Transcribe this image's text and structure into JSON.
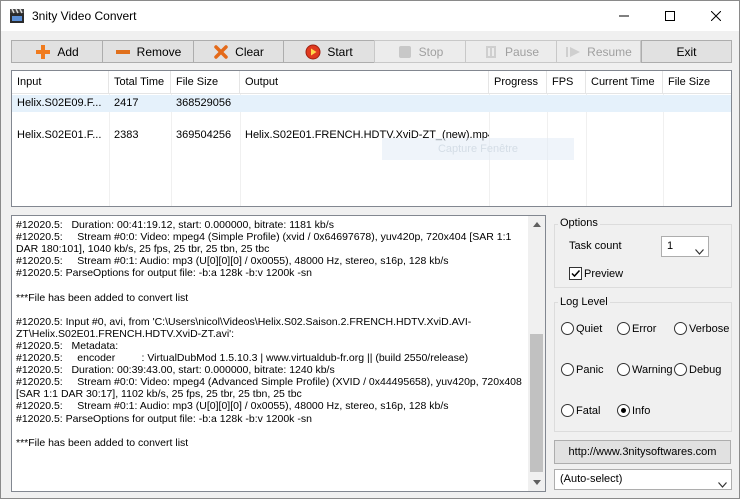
{
  "window": {
    "title": "3nity Video Convert"
  },
  "toolbar": {
    "add_label": "Add",
    "remove_label": "Remove",
    "clear_label": "Clear",
    "start_label": "Start",
    "stop_label": "Stop",
    "pause_label": "Pause",
    "resume_label": "Resume",
    "exit_label": "Exit"
  },
  "list": {
    "columns": [
      "Input",
      "Total Time",
      "File Size",
      "Output",
      "Progress",
      "FPS",
      "Current Time",
      "File Size"
    ],
    "rows": [
      {
        "input": "Helix.S02E09.F...",
        "total_time": "2417",
        "file_size": "368529056",
        "output": ""
      },
      {
        "input": "Helix.S02E01.F...",
        "total_time": "2383",
        "file_size": "369504256",
        "output": "Helix.S02E01.FRENCH.HDTV.XviD-ZT_(new).mp4"
      }
    ],
    "ghost_text": "Capture Fenêtre"
  },
  "log": {
    "text": "#12020.5:   Duration: 00:41:19.12, start: 0.000000, bitrate: 1181 kb/s\n#12020.5:     Stream #0:0: Video: mpeg4 (Simple Profile) (xvid / 0x64697678), yuv420p, 720x404 [SAR 1:1 DAR 180:101], 1040 kb/s, 25 fps, 25 tbr, 25 tbn, 25 tbc\n#12020.5:     Stream #0:1: Audio: mp3 (U[0][0][0] / 0x0055), 48000 Hz, stereo, s16p, 128 kb/s\n#12020.5: ParseOptions for output file: -b:a 128k -b:v 1200k -sn\n\n***File has been added to convert list\n\n#12020.5: Input #0, avi, from 'C:\\Users\\nicol\\Videos\\Helix.S02.Saison.2.FRENCH.HDTV.XviD.AVI-ZT\\Helix.S02E01.FRENCH.HDTV.XviD-ZT.avi':\n#12020.5:   Metadata:\n#12020.5:     encoder         : VirtualDubMod 1.5.10.3 | www.virtualdub-fr.org || (build 2550/release)\n#12020.5:   Duration: 00:39:43.00, start: 0.000000, bitrate: 1240 kb/s\n#12020.5:     Stream #0:0: Video: mpeg4 (Advanced Simple Profile) (XVID / 0x44495658), yuv420p, 720x408 [SAR 1:1 DAR 30:17], 1102 kb/s, 25 fps, 25 tbr, 25 tbn, 25 tbc\n#12020.5:     Stream #0:1: Audio: mp3 (U[0][0][0] / 0x0055), 48000 Hz, stereo, s16p, 128 kb/s\n#12020.5: ParseOptions for output file: -b:a 128k -b:v 1200k -sn\n\n***File has been added to convert list"
  },
  "options": {
    "title": "Options",
    "task_count_label": "Task count",
    "task_count_value": "1",
    "preview_label": "Preview",
    "preview_checked": true
  },
  "log_level": {
    "title": "Log Level",
    "quiet": "Quiet",
    "error": "Error",
    "verbose": "Verbose",
    "panic": "Panic",
    "warning": "Warning",
    "debug": "Debug",
    "fatal": "Fatal",
    "info": "Info",
    "selected": "Info"
  },
  "link_label": "http://www.3nitysoftwares.com",
  "autoselect_value": "(Auto-select)",
  "colors": {
    "selected_row": "#e5f1fb",
    "button_face": "#e1e1e1",
    "window_bg": "#f0f0f0"
  }
}
